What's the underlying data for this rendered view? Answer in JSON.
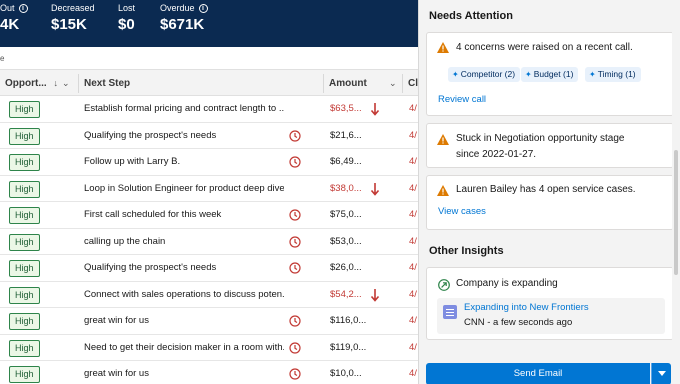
{
  "metrics": [
    {
      "label": "Out",
      "value": "4K",
      "info": true
    },
    {
      "label": "Decreased",
      "value": "$15K",
      "info": false
    },
    {
      "label": "Lost",
      "value": "$0",
      "info": false
    },
    {
      "label": "Overdue",
      "value": "$671K",
      "info": true
    }
  ],
  "subrow_text": "e",
  "table": {
    "columns": [
      "Opport...",
      "Next Step",
      "Amount",
      "Cl"
    ],
    "rows": [
      {
        "priority": "High",
        "next_step": "Establish formal pricing and contract length to ...",
        "amount": "$63,5...",
        "amount_red": true,
        "icon": "down-arrow",
        "close": "4/"
      },
      {
        "priority": "High",
        "next_step": "Qualifying the prospect's needs",
        "amount": "$21,6...",
        "amount_red": false,
        "icon": "clock",
        "close": "4/"
      },
      {
        "priority": "High",
        "next_step": "Follow up with Larry B.",
        "amount": "$6,49...",
        "amount_red": false,
        "icon": "clock",
        "close": "4/"
      },
      {
        "priority": "High",
        "next_step": "Loop in Solution Engineer for product deep dive",
        "amount": "$38,0...",
        "amount_red": true,
        "icon": "down-arrow",
        "close": "4/"
      },
      {
        "priority": "High",
        "next_step": "First call scheduled for this week",
        "amount": "$75,0...",
        "amount_red": false,
        "icon": "clock",
        "close": "4/"
      },
      {
        "priority": "High",
        "next_step": "calling up the chain",
        "amount": "$53,0...",
        "amount_red": false,
        "icon": "clock",
        "close": "4/"
      },
      {
        "priority": "High",
        "next_step": "Qualifying the prospect's needs",
        "amount": "$26,0...",
        "amount_red": false,
        "icon": "clock",
        "close": "4/"
      },
      {
        "priority": "High",
        "next_step": "Connect with sales operations to discuss poten...",
        "amount": "$54,2...",
        "amount_red": true,
        "icon": "down-arrow",
        "close": "4/"
      },
      {
        "priority": "High",
        "next_step": "great win for us",
        "amount": "$116,0...",
        "amount_red": false,
        "icon": "clock",
        "close": "4/"
      },
      {
        "priority": "High",
        "next_step": "Need to get their decision maker in a room with...",
        "amount": "$119,0...",
        "amount_red": false,
        "icon": "clock",
        "close": "4/"
      },
      {
        "priority": "High",
        "next_step": "great win for us",
        "amount": "$10,0...",
        "amount_red": false,
        "icon": "clock",
        "close": "4/"
      }
    ]
  },
  "panel": {
    "needs_attention_title": "Needs Attention",
    "card1": {
      "text": "4 concerns were raised on a recent call.",
      "chips": [
        "Competitor (2)",
        "Budget (1)",
        "Timing (1)"
      ],
      "link": "Review call"
    },
    "card2": {
      "line1": "Stuck in Negotiation opportunity stage",
      "line2": "since 2022-01-27."
    },
    "card3": {
      "text": "Lauren Bailey has 4 open service cases.",
      "link": "View cases"
    },
    "other_insights_title": "Other Insights",
    "card4": {
      "text": "Company is expanding",
      "article_title": "Expanding into New Frontiers",
      "article_meta": "CNN - a few seconds ago"
    },
    "send_email": "Send Email"
  },
  "colors": {
    "header_bg": "#0b2a51",
    "accent": "#0176d3",
    "warning": "#dd7a01",
    "negative": "#c23934",
    "pill_green": "#2e844a"
  }
}
